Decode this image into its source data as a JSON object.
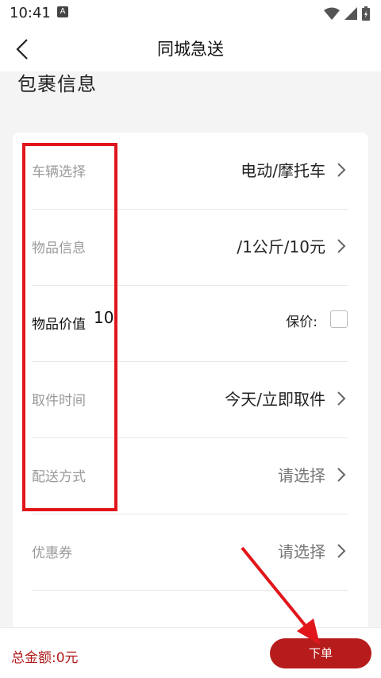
{
  "status_bar": {
    "time": "10:41",
    "icon_a": "A"
  },
  "nav": {
    "title": "同城急送"
  },
  "section": {
    "title": "包裹信息"
  },
  "rows": [
    {
      "label": "车辆选择",
      "value": "电动/摩托车"
    },
    {
      "label": "物品信息",
      "value": "/1公斤/10元"
    },
    {
      "label": "物品价值",
      "value": "10",
      "insure_label": "保价:"
    },
    {
      "label": "取件时间",
      "value": "今天/立即取件"
    },
    {
      "label": "配送方式",
      "value": "请选择"
    },
    {
      "label": "优惠券",
      "value": "请选择"
    }
  ],
  "bottom": {
    "total": "总金额:0元",
    "order_button": "下单"
  },
  "colors": {
    "accent": "#b71c1c",
    "highlight": "#e0161b"
  }
}
